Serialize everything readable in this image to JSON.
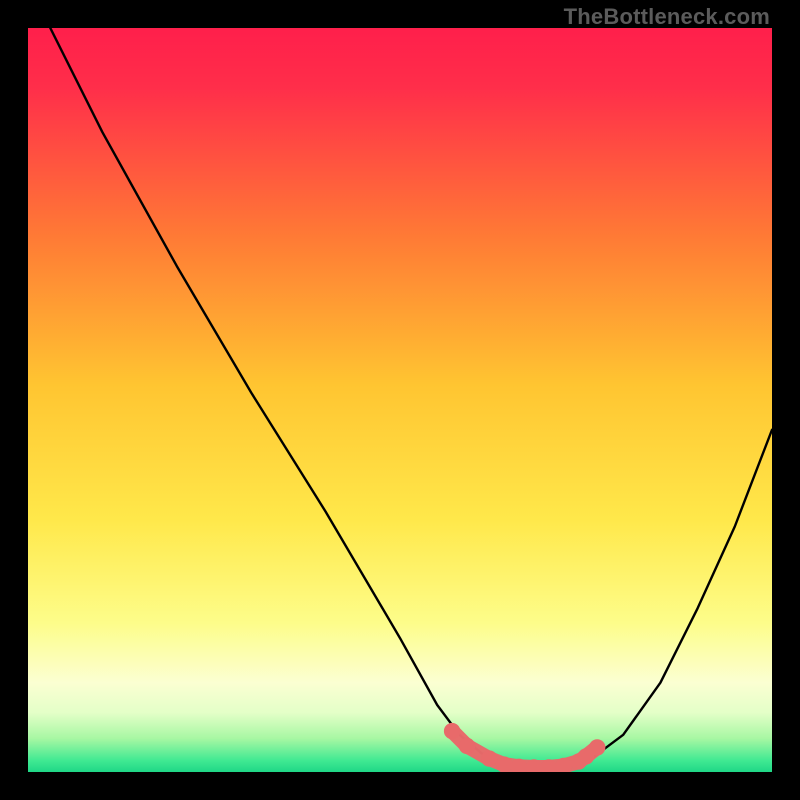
{
  "watermark": "TheBottleneck.com",
  "colors": {
    "frame": "#000000",
    "grad_top": "#ff1f4b",
    "grad_mid1": "#ff8a2a",
    "grad_mid2": "#ffd62a",
    "grad_mid3": "#fff96a",
    "grad_low": "#f6ffe0",
    "grad_bottom": "#2ee58b",
    "curve": "#000000",
    "dots": "#e86a6a",
    "dots_stroke": "#c94f4f"
  },
  "chart_data": {
    "type": "line",
    "title": "",
    "xlabel": "",
    "ylabel": "",
    "xlim": [
      0,
      100
    ],
    "ylim": [
      0,
      100
    ],
    "series": [
      {
        "name": "bottleneck-curve",
        "x": [
          3,
          10,
          20,
          30,
          40,
          50,
          55,
          58,
          61,
          64,
          67,
          70,
          73,
          76,
          80,
          85,
          90,
          95,
          100
        ],
        "y": [
          100,
          86,
          68,
          51,
          35,
          18,
          9,
          5,
          2.5,
          1.2,
          0.6,
          0.6,
          0.9,
          2,
          5,
          12,
          22,
          33,
          46
        ]
      }
    ],
    "highlight_points": {
      "name": "highlighted-range",
      "x": [
        57,
        59,
        62,
        64,
        66,
        68,
        70,
        72,
        74,
        75,
        76.5
      ],
      "y": [
        5.5,
        3.5,
        1.8,
        1.0,
        0.7,
        0.6,
        0.6,
        0.8,
        1.4,
        2.1,
        3.3
      ]
    }
  }
}
